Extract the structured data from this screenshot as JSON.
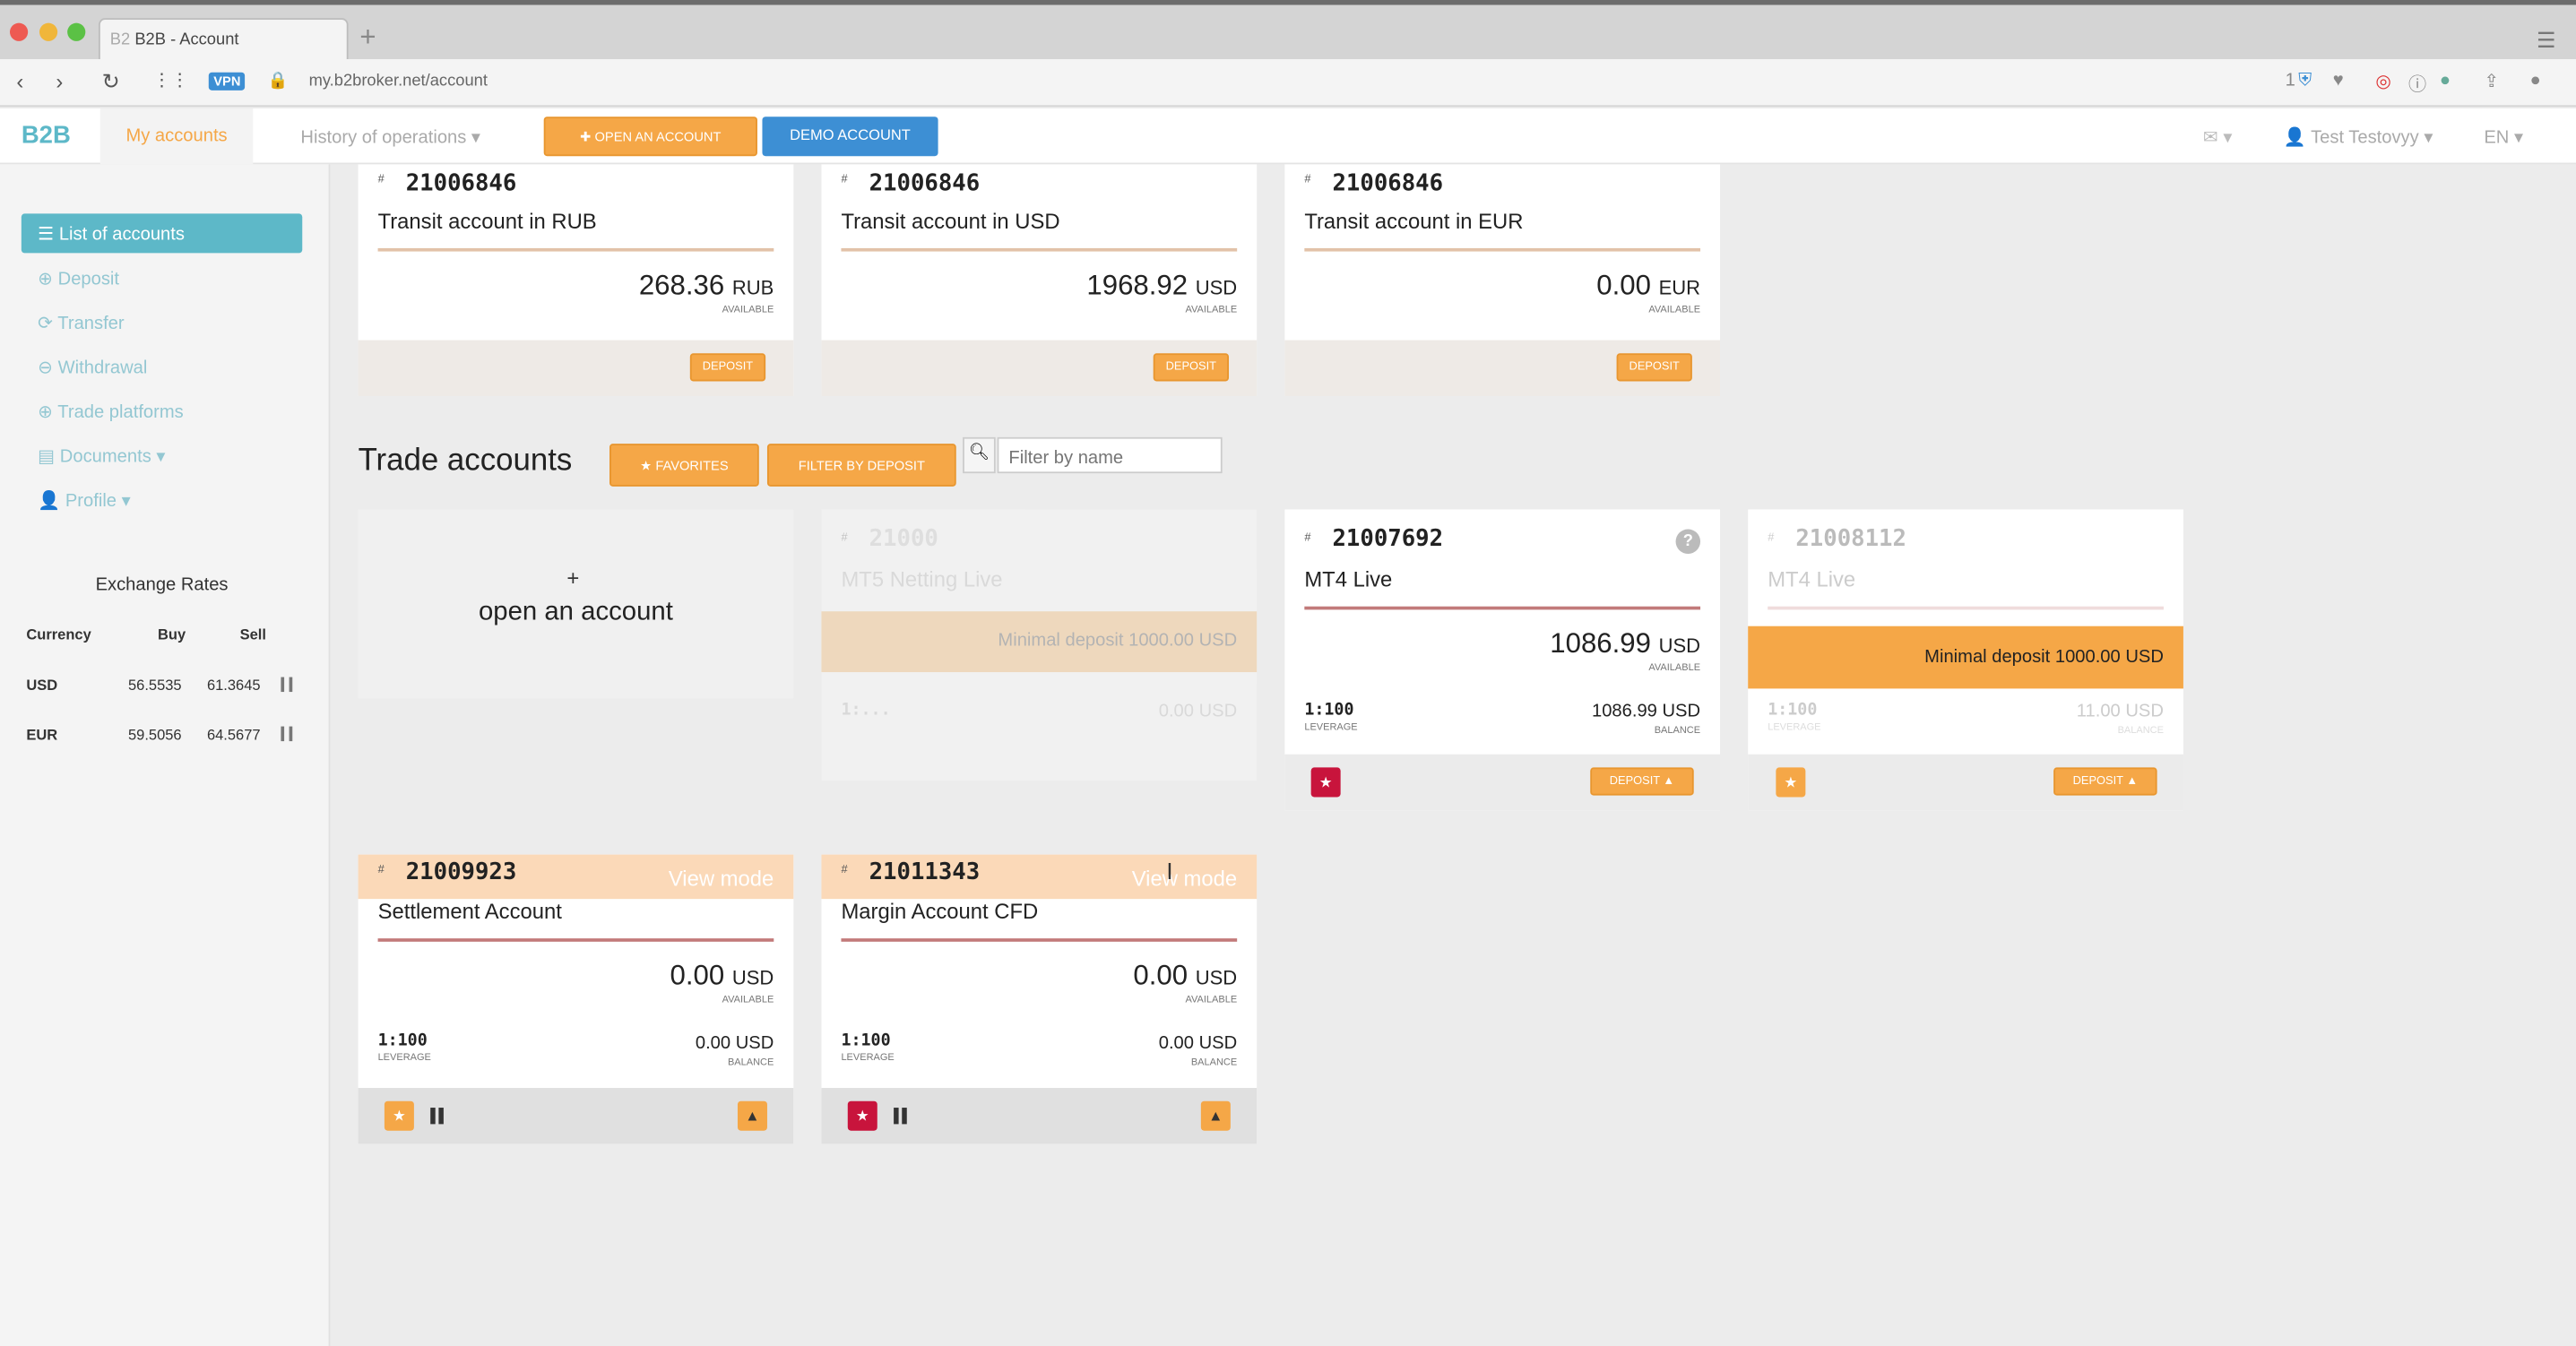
{
  "browser": {
    "tab_title": "B2B - Account",
    "tab_favicon": "B2",
    "new_tab": "+",
    "vpn": "VPN",
    "url": "my.b2broker.net/account",
    "ext_count": "1"
  },
  "header": {
    "logo": "B2B",
    "my_accounts": "My accounts",
    "history": "History of operations ▾",
    "open_account": "✚ OPEN AN ACCOUNT",
    "demo_account": "DEMO ACCOUNT",
    "mail": "✉ ▾",
    "user": "👤 Test Testovyy ▾",
    "lang": "EN ▾"
  },
  "sidebar": {
    "items": [
      {
        "label": "☰ List of accounts"
      },
      {
        "label": "⊕ Deposit"
      },
      {
        "label": "⟳ Transfer"
      },
      {
        "label": "⊖ Withdrawal"
      },
      {
        "label": "⊕ Trade platforms"
      },
      {
        "label": "▤ Documents ▾"
      },
      {
        "label": "👤 Profile ▾"
      }
    ],
    "exchange": {
      "title": "Exchange Rates",
      "headers": [
        "Currency",
        "Buy",
        "Sell"
      ],
      "rows": [
        {
          "currency": "USD",
          "buy": "56.5535",
          "sell": "61.3645"
        },
        {
          "currency": "EUR",
          "buy": "59.5056",
          "sell": "64.5677"
        }
      ]
    }
  },
  "transit": [
    {
      "hash": "#",
      "number": "21006846",
      "name": "Transit account in RUB",
      "amount": "268.36",
      "currency": "RUB",
      "available": "AVAILABLE",
      "button": "DEPOSIT"
    },
    {
      "hash": "#",
      "number": "21006846",
      "name": "Transit account in USD",
      "amount": "1968.92",
      "currency": "USD",
      "available": "AVAILABLE",
      "button": "DEPOSIT"
    },
    {
      "hash": "#",
      "number": "21006846",
      "name": "Transit account in EUR",
      "amount": "0.00",
      "currency": "EUR",
      "available": "AVAILABLE",
      "button": "DEPOSIT"
    }
  ],
  "trade": {
    "title": "Trade accounts",
    "favorites": "★ FAVORITES",
    "filter_by_deposit": "FILTER BY DEPOSIT",
    "search_icon": "search-icon",
    "filter_placeholder": "Filter by name",
    "open_plus": "+",
    "open_label": "open an account",
    "mt5": {
      "hash": "#",
      "number": "21000",
      "name": "MT5 Netting Live",
      "min_deposit": "Minimal deposit 1000.00 USD",
      "lev": "1:...",
      "balance": "0.00 USD"
    },
    "mt4a": {
      "hash": "#",
      "number": "21007692",
      "name": "MT4 Live",
      "help": "?",
      "amount": "1086.99",
      "currency": "USD",
      "available": "AVAILABLE",
      "leverage": "1:100",
      "leverage_label": "LEVERAGE",
      "balance": "1086.99 USD",
      "balance_label": "BALANCE",
      "button": "DEPOSIT ▲",
      "star": "★"
    },
    "mt4b": {
      "hash": "#",
      "number": "21008112",
      "name": "MT4 Live",
      "min_deposit": "Minimal deposit 1000.00 USD",
      "leverage": "1:100",
      "leverage_label": "LEVERAGE",
      "balance": "11.00 USD",
      "balance_label": "BALANCE",
      "button": "DEPOSIT ▲",
      "star": "★"
    },
    "settlement": {
      "hash": "#",
      "number": "21009923",
      "name": "Settlement Account",
      "view_mode": "View mode",
      "amount": "0.00",
      "currency": "USD",
      "available": "AVAILABLE",
      "leverage": "1:100",
      "leverage_label": "LEVERAGE",
      "balance": "0.00 USD",
      "balance_label": "BALANCE",
      "star": "★",
      "up": "▲"
    },
    "margin": {
      "hash": "#",
      "number": "21011343",
      "name": "Margin Account CFD",
      "view_mode": "View mode",
      "amount": "0.00",
      "currency": "USD",
      "available": "AVAILABLE",
      "leverage": "1:100",
      "leverage_label": "LEVERAGE",
      "balance": "0.00 USD",
      "balance_label": "BALANCE",
      "star": "★",
      "up": "▲"
    }
  },
  "colors": {
    "accent": "#f5a747",
    "teal": "#5db8c8",
    "blue": "#3d8fd4",
    "red": "#c8143c"
  }
}
